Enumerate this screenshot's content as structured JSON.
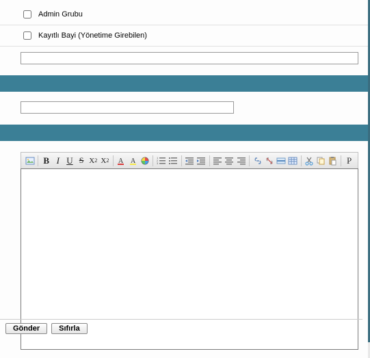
{
  "checkboxes": {
    "admin_group": {
      "label": "Admin Grubu",
      "checked": false
    },
    "registered_dealer": {
      "label": "Kayıtlı Bayi (Yönetime Girebilen)",
      "checked": false
    }
  },
  "fields": {
    "field1": {
      "value": "",
      "placeholder": ""
    },
    "field2": {
      "value": "",
      "placeholder": ""
    }
  },
  "editor": {
    "content": "",
    "toolbar": {
      "image": "image-icon",
      "bold": "B",
      "italic": "I",
      "underline": "U",
      "strike": "S",
      "subscript": "X₂",
      "superscript": "X²",
      "fontcolor": "font-color-icon",
      "highlight": "highlight-icon",
      "bgcolor": "bg-color-icon",
      "olist": "ordered-list-icon",
      "ulist": "unordered-list-icon",
      "indent": "indent-icon",
      "outdent": "outdent-icon",
      "alignleft": "align-left-icon",
      "aligncenter": "align-center-icon",
      "alignright": "align-right-icon",
      "link": "link-icon",
      "unlink": "unlink-icon",
      "hr": "horizontal-rule-icon",
      "table": "table-icon",
      "cut": "cut-icon",
      "copy": "copy-icon",
      "paste": "paste-icon",
      "plaintext": "P"
    }
  },
  "buttons": {
    "submit": "Gönder",
    "reset": "Sıfırla"
  }
}
